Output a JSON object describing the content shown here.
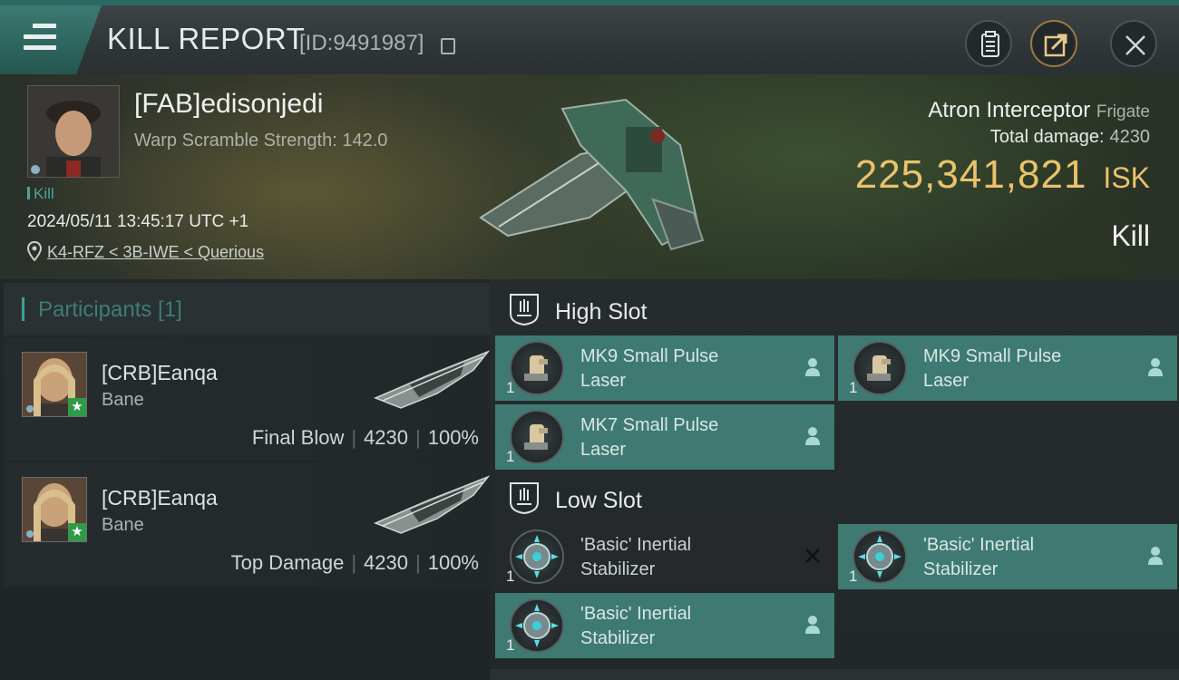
{
  "header": {
    "title": "KILL REPORT",
    "id_label": "[ID:9491987]",
    "menu_icon": "hamburger-icon",
    "buttons": [
      "clipboard-icon",
      "share-icon",
      "close-icon"
    ]
  },
  "victim": {
    "name": "[FAB]edisonjedi",
    "warp_scramble": "Warp Scramble Strength: 142.0",
    "kill_tag": "Kill",
    "datetime": "2024/05/11 13:45:17 UTC +1",
    "location": "K4-RFZ < 3B-IWE < Querious",
    "ship_name": "Atron Interceptor",
    "ship_class": "Frigate",
    "total_damage_label": "Total damage:",
    "total_damage_value": "4230",
    "isk_value": "225,341,821",
    "isk_unit": "ISK",
    "result": "Kill"
  },
  "participants": {
    "title": "Participants [1]",
    "rows": [
      {
        "name": "[CRB]Eanqa",
        "ship": "Bane",
        "label": "Final Blow",
        "damage": "4230",
        "percent": "100%"
      },
      {
        "name": "[CRB]Eanqa",
        "ship": "Bane",
        "label": "Top Damage",
        "damage": "4230",
        "percent": "100%"
      }
    ]
  },
  "fittings": {
    "high_slot": {
      "title": "High Slot",
      "modules": [
        {
          "line1": "MK9 Small Pulse",
          "line2": "Laser",
          "qty": "1"
        },
        {
          "line1": "MK9 Small Pulse",
          "line2": "Laser",
          "qty": "1"
        },
        {
          "line1": "MK7 Small Pulse",
          "line2": "Laser",
          "qty": "1"
        }
      ]
    },
    "low_slot": {
      "title": "Low Slot",
      "modules": [
        {
          "line1": "'Basic' Inertial",
          "line2": "Stabilizer",
          "qty": "1",
          "status": "destroyed"
        },
        {
          "line1": "'Basic' Inertial",
          "line2": "Stabilizer",
          "qty": "1",
          "status": "dropped"
        },
        {
          "line1": "'Basic' Inertial",
          "line2": "Stabilizer",
          "qty": "1",
          "status": "dropped"
        }
      ]
    }
  },
  "colors": {
    "accent_teal": "#3e7a72",
    "isk_gold": "#e9c26a",
    "participants_teal": "#3c7e76"
  }
}
